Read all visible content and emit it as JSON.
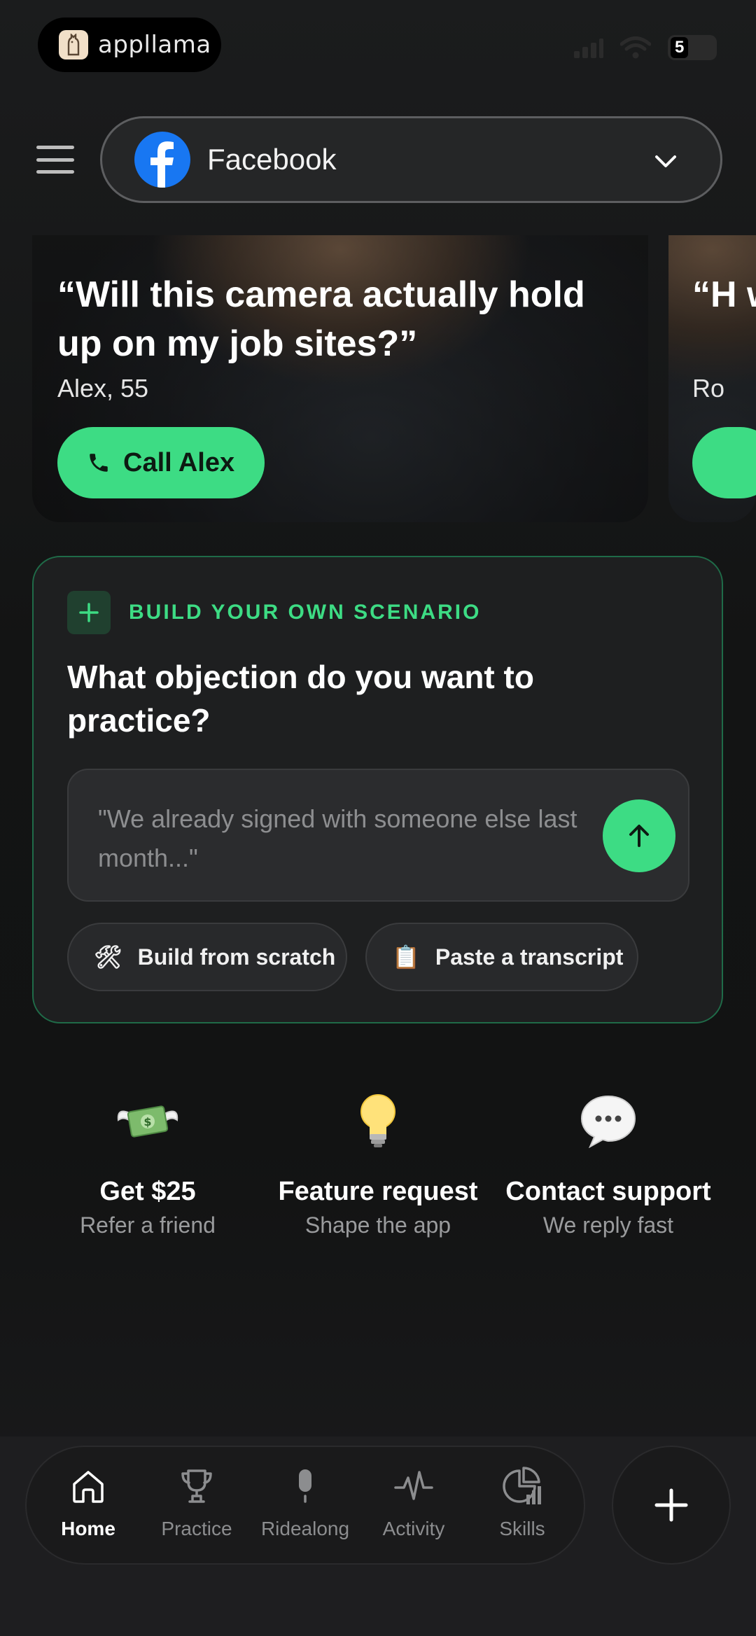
{
  "status_bar": {
    "app_name": "appllama",
    "battery": "5"
  },
  "header": {
    "platform": "Facebook"
  },
  "cards": [
    {
      "quote": "“Will this camera actually hold up on my job sites?”",
      "persona": "Alex, 55",
      "call_label": "Call Alex"
    },
    {
      "quote": "“H w",
      "persona": "Ro",
      "call_label": ""
    }
  ],
  "scenario": {
    "tag": "BUILD YOUR OWN SCENARIO",
    "question": "What objection do you want to practice?",
    "placeholder": "\"We already signed with someone else last month...\"",
    "chips": [
      {
        "icon": "hammer-wrench-icon",
        "label": "Build from scratch"
      },
      {
        "icon": "clipboard-icon",
        "label": "Paste a transcript"
      }
    ]
  },
  "quick_links": [
    {
      "title": "Get $25",
      "subtitle": "Refer a friend",
      "icon": "money-wings-icon"
    },
    {
      "title": "Feature request",
      "subtitle": "Shape the app",
      "icon": "lightbulb-icon"
    },
    {
      "title": "Contact support",
      "subtitle": "We reply fast",
      "icon": "speech-bubble-icon"
    }
  ],
  "nav": [
    {
      "label": "Home",
      "icon": "home-icon",
      "active": true
    },
    {
      "label": "Practice",
      "icon": "trophy-icon",
      "active": false
    },
    {
      "label": "Ridealong",
      "icon": "microphone-icon",
      "active": false
    },
    {
      "label": "Activity",
      "icon": "activity-icon",
      "active": false
    },
    {
      "label": "Skills",
      "icon": "skills-chart-icon",
      "active": false
    }
  ],
  "colors": {
    "accent": "#3ddc84",
    "facebook": "#1877f2",
    "background": "#131414"
  }
}
